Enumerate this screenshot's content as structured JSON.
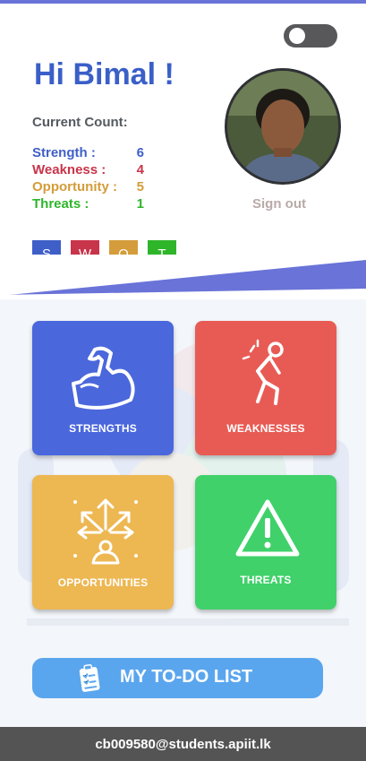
{
  "header": {
    "greeting": "Hi Bimal !",
    "count_title": "Current Count:",
    "counts": [
      {
        "label": "Strength :",
        "value": "6",
        "color": "#3f5fc8"
      },
      {
        "label": "Weakness :",
        "value": "4",
        "color": "#c8344a"
      },
      {
        "label": "Opportunity :",
        "value": "5",
        "color": "#d49c3a"
      },
      {
        "label": "Threats :",
        "value": "1",
        "color": "#2fb52a"
      }
    ],
    "sign_out": "Sign out",
    "swot_letters": [
      "S",
      "W",
      "O",
      "T"
    ]
  },
  "tiles": {
    "strengths": "STRENGTHS",
    "weaknesses": "WEAKNESSES",
    "opportunities": "OPPORTUNITIES",
    "threats": "THREATS"
  },
  "todo": {
    "label": "MY TO-DO LIST"
  },
  "footer": {
    "email": "cb009580@students.apiit.lk"
  },
  "colors": {
    "strengths": "#4a67dc",
    "weaknesses": "#e85b55",
    "opportunities": "#edb752",
    "threats": "#40d16a",
    "todo": "#5aa6ee"
  }
}
